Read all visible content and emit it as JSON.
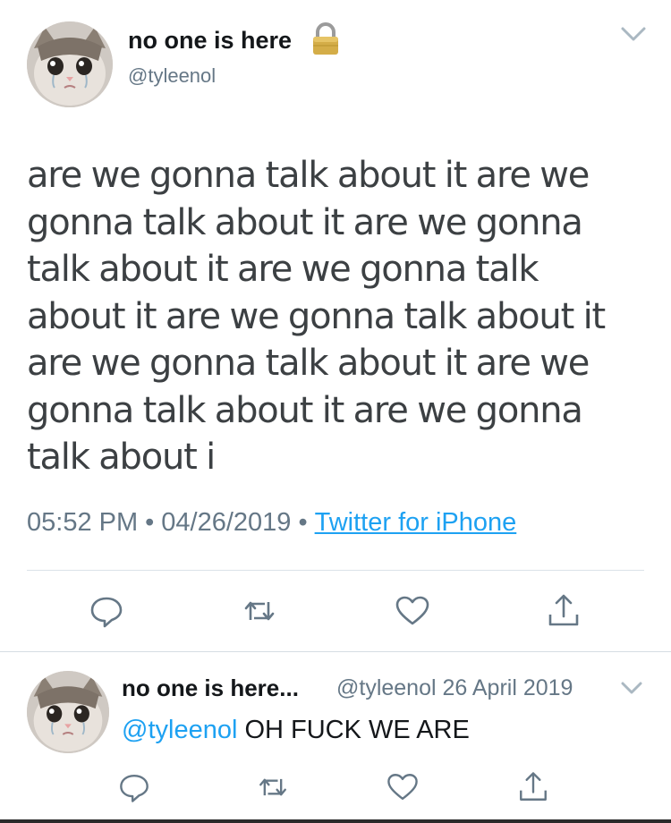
{
  "main_tweet": {
    "display_name": "no one is here",
    "handle": "@tyleenol",
    "text": "are we gonna talk about it are we gonna talk about it are we gonna talk about it are we gonna talk about it are we gonna talk about it are we gonna talk about it are we gonna talk about it are we gonna talk about i",
    "time": "05:52 PM",
    "date": "04/26/2019",
    "separator": "•",
    "source": "Twitter for iPhone",
    "icons": {
      "lock": "lock-icon",
      "menu": "chevron-down-icon",
      "reply": "reply-icon",
      "retweet": "retweet-icon",
      "like": "heart-icon",
      "share": "share-icon"
    }
  },
  "reply_tweet": {
    "display_name": "no one is here...",
    "handle_date": "@tyleenol 26 April 2019",
    "mention": "@tyleenol",
    "text": " OH FUCK WE ARE"
  },
  "colors": {
    "link_blue": "#1da1f2",
    "muted_gray": "#657786",
    "icon_gray": "#657786",
    "text_dark": "#14171a",
    "lock_gold": "#c9a43a"
  }
}
